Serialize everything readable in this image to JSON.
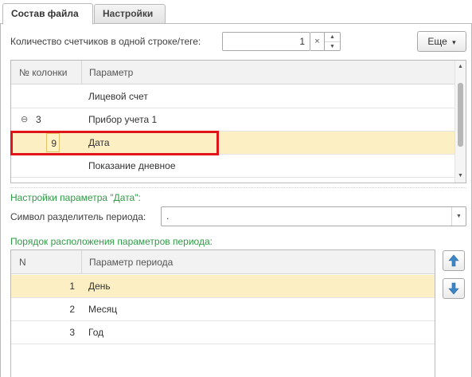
{
  "tabs": [
    {
      "label": "Состав файла",
      "active": true
    },
    {
      "label": "Настройки",
      "active": false
    }
  ],
  "counter": {
    "label": "Количество счетчиков в одной строке/теге:",
    "value": "1",
    "clear_glyph": "×",
    "spin_up_glyph": "▲",
    "spin_down_glyph": "▼"
  },
  "more_button": {
    "label": "Еще",
    "icon": "dropdown-caret-icon",
    "caret": "▾"
  },
  "columns_table": {
    "headers": [
      "№ колонки",
      "Параметр"
    ],
    "rows": [
      {
        "number": "",
        "param": "Лицевой счет",
        "expand": ""
      },
      {
        "number": "3",
        "param": "Прибор учета 1",
        "expand": "⊖"
      },
      {
        "number": "9",
        "param": "Дата",
        "expand": "",
        "selected": true
      },
      {
        "number": "",
        "param": "Показание дневное",
        "expand": ""
      }
    ],
    "scroll_up": "▲",
    "scroll_down": "▼"
  },
  "param_settings": {
    "title": "Настройки параметра \"Дата\":",
    "separator_label": "Символ разделитель периода:",
    "separator_value": ".",
    "dropdown_glyph": "▼"
  },
  "period_order": {
    "title": "Порядок расположения параметров периода:",
    "headers": [
      "N",
      "Параметр периода"
    ],
    "rows": [
      {
        "n": "1",
        "param": "День",
        "selected": true
      },
      {
        "n": "2",
        "param": "Месяц"
      },
      {
        "n": "3",
        "param": "Год"
      }
    ],
    "move_up_icon": "arrow-up-icon",
    "move_down_icon": "arrow-down-icon"
  },
  "colors": {
    "accent_green": "#2f9a46",
    "selection": "#fcefc4",
    "highlight_frame": "#e0141b",
    "arrow_blue": "#3d86c6"
  }
}
